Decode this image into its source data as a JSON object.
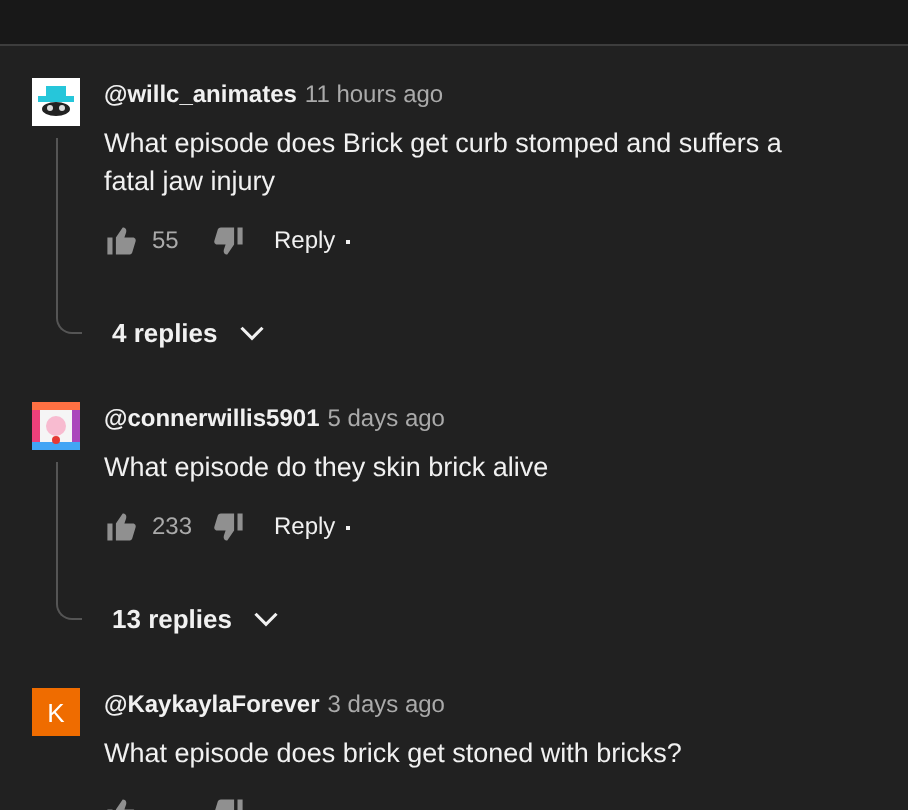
{
  "comments": [
    {
      "avatar": {
        "kind": "hat"
      },
      "handle": "@willc_animates",
      "time": "11 hours ago",
      "text": "What episode does Brick get curb stomped and suffers a fatal jaw injury",
      "likes": "55",
      "reply": "Reply",
      "replies": "4 replies"
    },
    {
      "avatar": {
        "kind": "collage"
      },
      "handle": "@connerwillis5901",
      "time": "5 days ago",
      "text": "What episode do they skin brick alive",
      "likes": "233",
      "reply": "Reply",
      "replies": "13 replies"
    },
    {
      "avatar": {
        "kind": "letter",
        "letter": "K",
        "color": "#ef6c00"
      },
      "handle": "@KaykaylaForever",
      "time": "3 days ago",
      "text": "What episode does brick get stoned with bricks?"
    }
  ]
}
